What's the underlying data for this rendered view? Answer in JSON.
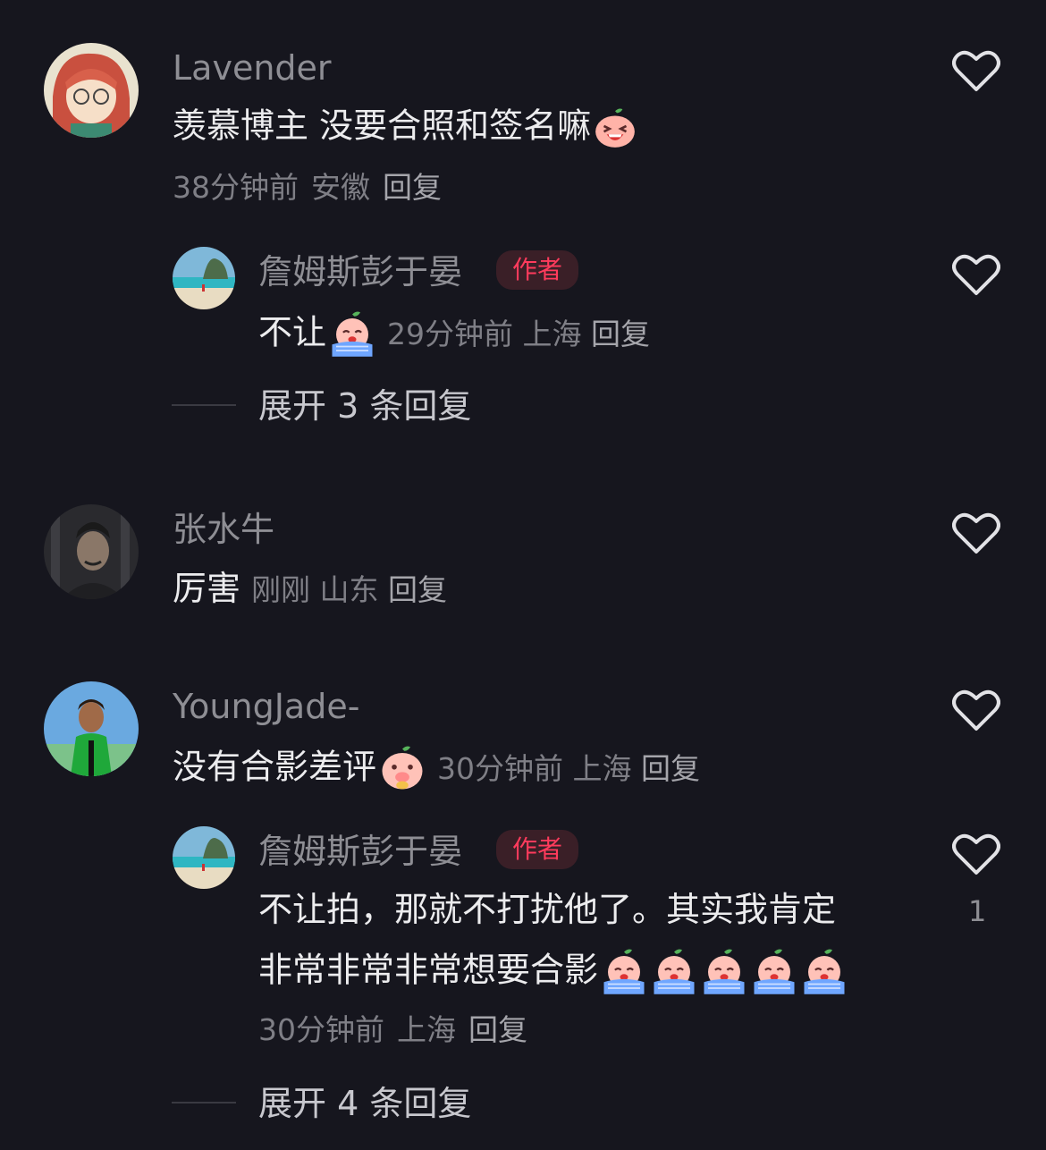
{
  "comments": [
    {
      "name": "Lavender",
      "text": "羡慕博主 没要合照和签名嘛",
      "time": "38分钟前",
      "location": "安徽",
      "reply": "回复",
      "reply_item": {
        "name": "詹姆斯彭于晏",
        "badge": "作者",
        "text": "不让",
        "time": "29分钟前",
        "location": "上海",
        "reply": "回复"
      },
      "expand": "展开 3 条回复"
    },
    {
      "name": "张水牛",
      "text": "厉害",
      "time": "刚刚",
      "location": "山东",
      "reply": "回复"
    },
    {
      "name": "YoungJade-",
      "text": "没有合影差评",
      "time": "30分钟前",
      "location": "上海",
      "reply": "回复",
      "reply_item": {
        "name": "詹姆斯彭于晏",
        "badge": "作者",
        "text_line1": "不让拍，那就不打扰他了。其实我肯定",
        "text_line2": "非常非常非常想要合影",
        "time": "30分钟前",
        "location": "上海",
        "reply": "回复",
        "likes": "1"
      },
      "expand": "展开 4 条回复"
    }
  ],
  "icons": {
    "heart": "heart-outline-icon",
    "emoji_laugh": "laughing-face-emoji",
    "emoji_cry": "crying-face-emoji"
  },
  "colors": {
    "background": "#16161e",
    "author_badge_text": "#ff3b5c",
    "author_badge_bg": "#3a1f27"
  }
}
